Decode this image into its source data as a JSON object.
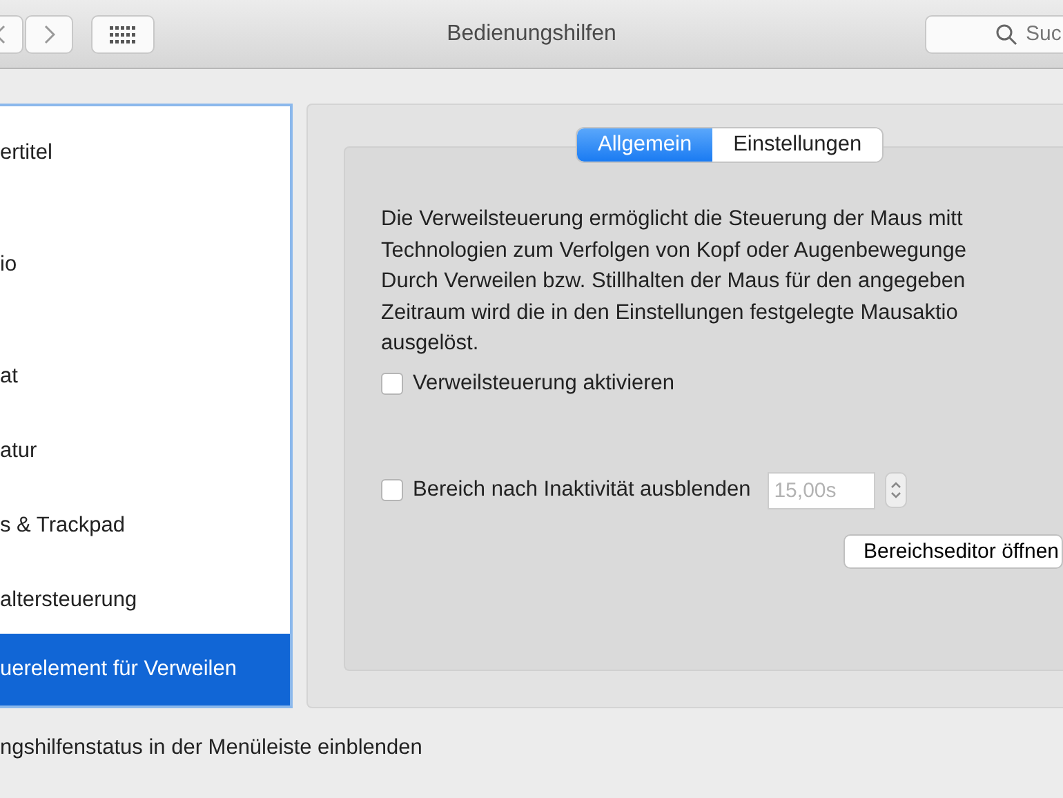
{
  "window": {
    "title": "Bedienungshilfen"
  },
  "toolbar": {
    "search": {
      "placeholder": "Suc"
    }
  },
  "sidebar": {
    "items": [
      {
        "label": "ertitel",
        "selected": false
      },
      {
        "label": "io",
        "selected": false
      },
      {
        "label": "at",
        "selected": false
      },
      {
        "label": "atur",
        "selected": false
      },
      {
        "label": "s & Trackpad",
        "selected": false
      },
      {
        "label": "altersteuerung",
        "selected": false
      },
      {
        "label": "uerelement für Verweilen",
        "selected": true
      }
    ]
  },
  "tabs": [
    {
      "label": "Allgemein",
      "selected": true
    },
    {
      "label": "Einstellungen",
      "selected": false
    }
  ],
  "description": [
    "Die Verweilsteuerung ermöglicht die Steuerung der Maus mitt",
    "Technologien zum Verfolgen von Kopf oder Augenbewegunge",
    "Durch Verweilen bzw. Stillhalten der Maus für den angegeben",
    "Zeitraum wird die in den Einstellungen festgelegte Mausaktio",
    "ausgelöst."
  ],
  "enable_checkbox": {
    "label": "Verweilsteuerung aktivieren",
    "checked": false
  },
  "hide_checkbox": {
    "label": "Bereich nach Inaktivität ausblenden",
    "checked": false
  },
  "timeout_field": {
    "value": "15,00s",
    "disabled": true
  },
  "editor_button": {
    "label": "Bereichseditor öffnen"
  },
  "status_checkbox": {
    "label": "ngshilfenstatus in der Menüleiste einblenden"
  }
}
